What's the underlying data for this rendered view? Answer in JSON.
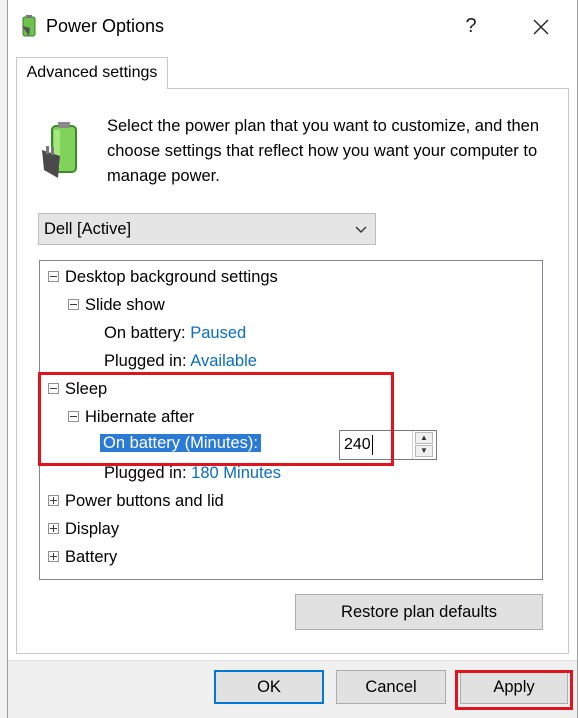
{
  "window": {
    "title": "Power Options",
    "help_label": "?",
    "close_label": "✕"
  },
  "tab": {
    "label": "Advanced settings"
  },
  "intro": {
    "text": "Select the power plan that you want to customize, and then choose settings that reflect how you want your computer to manage power."
  },
  "plan_select": {
    "value": "Dell [Active]"
  },
  "tree": {
    "desktop_bg": "Desktop background settings",
    "slide_show": "Slide show",
    "on_battery_label": "On battery:",
    "on_battery_value": "Paused",
    "plugged_in_label": "Plugged in:",
    "plugged_in_value": "Available",
    "sleep": "Sleep",
    "hibernate_after": "Hibernate after",
    "hib_on_battery_label": "On battery (Minutes):",
    "hib_on_battery_value": "240",
    "hib_plugged_in_label": "Plugged in:",
    "hib_plugged_in_value": "180 Minutes",
    "power_buttons": "Power buttons and lid",
    "display": "Display",
    "battery": "Battery"
  },
  "buttons": {
    "restore": "Restore plan defaults",
    "ok": "OK",
    "cancel": "Cancel",
    "apply": "Apply"
  },
  "colors": {
    "accent": "#0078d7",
    "link_value": "#0a6ebd",
    "highlight": "#2b7ad6",
    "annotation_red": "#e0141e"
  }
}
